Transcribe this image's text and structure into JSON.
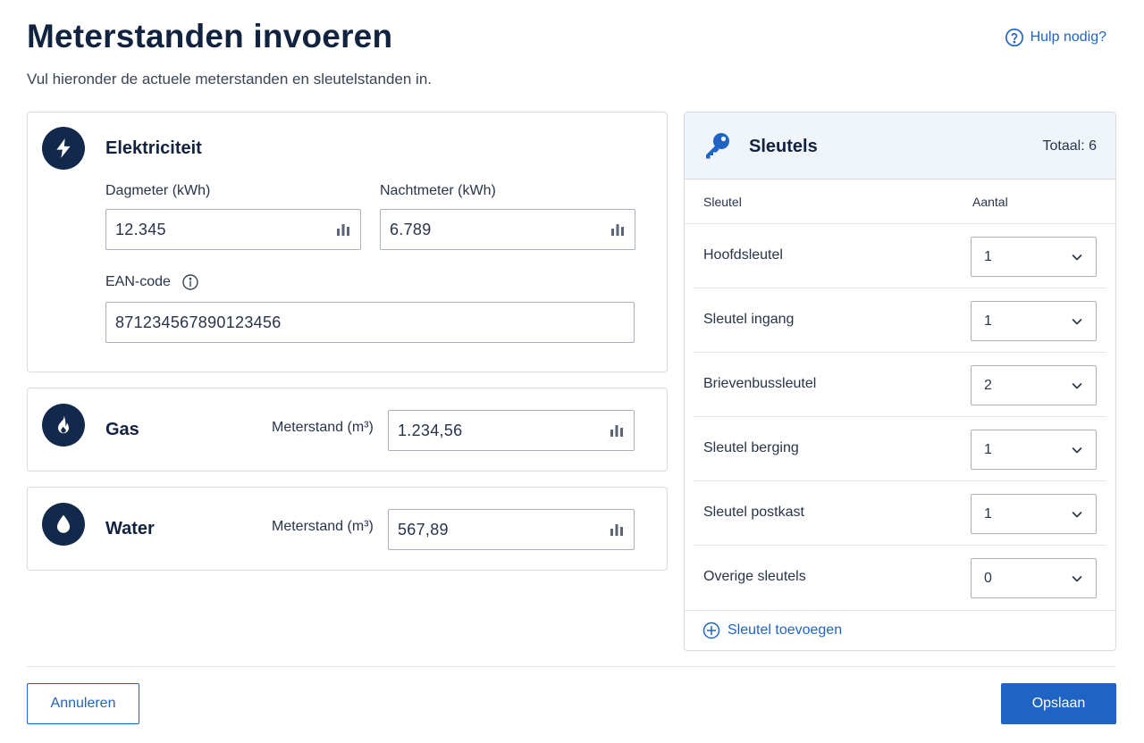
{
  "header": {
    "title": "Meterstanden invoeren",
    "subtitle": "Vul hieronder de actuele meterstanden en sleutelstanden in.",
    "help_label": "Hulp nodig?"
  },
  "electricity": {
    "title": "Elektriciteit",
    "day_label": "Dagmeter (kWh)",
    "day_value": "12.345",
    "night_label": "Nachtmeter (kWh)",
    "night_value": "6.789",
    "ean_label": "EAN-code",
    "ean_value": "871234567890123456"
  },
  "gas": {
    "title": "Gas",
    "reading_label": "Meterstand (m³)",
    "reading_value": "1.234,56"
  },
  "water": {
    "title": "Water",
    "reading_label": "Meterstand (m³)",
    "reading_value": "567,89"
  },
  "keys": {
    "title": "Sleutels",
    "total": "Totaal: 6",
    "col_key": "Sleutel",
    "col_count": "Aantal",
    "rows": [
      {
        "name": "Hoofdsleutel",
        "count": "1"
      },
      {
        "name": "Sleutel ingang",
        "count": "1"
      },
      {
        "name": "Brievenbussleutel",
        "count": "2"
      },
      {
        "name": "Sleutel berging",
        "count": "1"
      },
      {
        "name": "Sleutel postkast",
        "count": "1"
      },
      {
        "name": "Overige sleutels",
        "count": "0"
      }
    ],
    "add_label": "Sleutel toevoegen"
  },
  "actions": {
    "cancel_label": "Annuleren",
    "save_label": "Opslaan"
  },
  "colors": {
    "accent": "#1f64c5",
    "icon_bg": "#13294b",
    "header_bg": "#f0f5fc"
  },
  "icons": {
    "help": "question-circle-icon",
    "electricity": "lightning-icon",
    "gas": "flame-icon",
    "water": "droplet-icon",
    "keys": "key-icon",
    "input_trailing": "bar-chart-icon",
    "ean_info": "info-icon",
    "select": "chevron-down-icon",
    "add": "plus-circle-icon"
  }
}
